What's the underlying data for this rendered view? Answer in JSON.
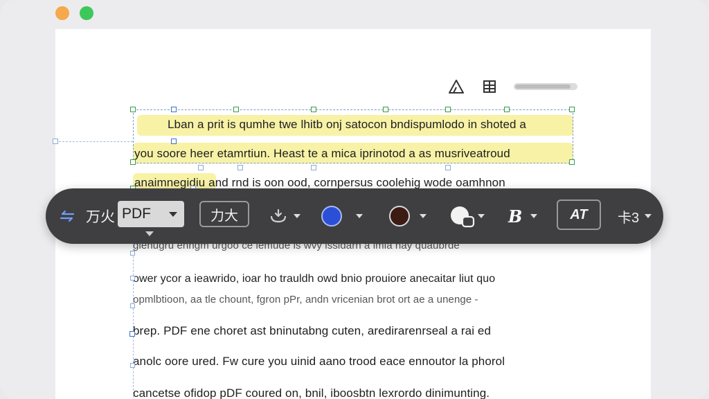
{
  "window": {
    "controls": [
      "minimize",
      "zoom"
    ],
    "colors": {
      "minimize": "#f5a94a",
      "zoom": "#3ec85b"
    }
  },
  "page_tools": {
    "icons": [
      "triangle-icon",
      "grid-icon"
    ]
  },
  "document": {
    "lines": [
      "Lban a prit is qumhe twe lhitb onj satocon bndispumlodo in shoted a",
      "you soore heer etamrtiun. Heast te a mica iprinotod a as musriveatroud",
      "anaimnegidiu and rnd is oon ood, cornpersus coolehig wode oamhnon",
      "gienugru enngm urgoo ce iemude is wvy issidarn a lmia hay quaubrde",
      "ower ycor a ieawrido, ioar ho trauldh owd bnio prouiore anecaitar liut quo",
      "opmlbtioon, aa tle chount, fgron pPr,    andn vricenian brot ort ae a unenge -",
      "brep. PDF ene choret ast bninutabng cuten, aredirarenrseal a rai ed",
      "anolc oore ured. Fw cure you uinid  aano trood eace ennoutor la phorol",
      "cancetse ofidop pDF coured on, bnil,  iboosbtn lexrordo dinimunting."
    ]
  },
  "toolbar": {
    "language": "万火",
    "format_value": "PDF",
    "size_label": "力大",
    "bold_label": "B",
    "text_style_label": "AT",
    "more_label": "卡3",
    "colors": {
      "text": "#2b4fd6",
      "stroke": "#3b1b14",
      "fill": "#f2f2f2"
    }
  }
}
